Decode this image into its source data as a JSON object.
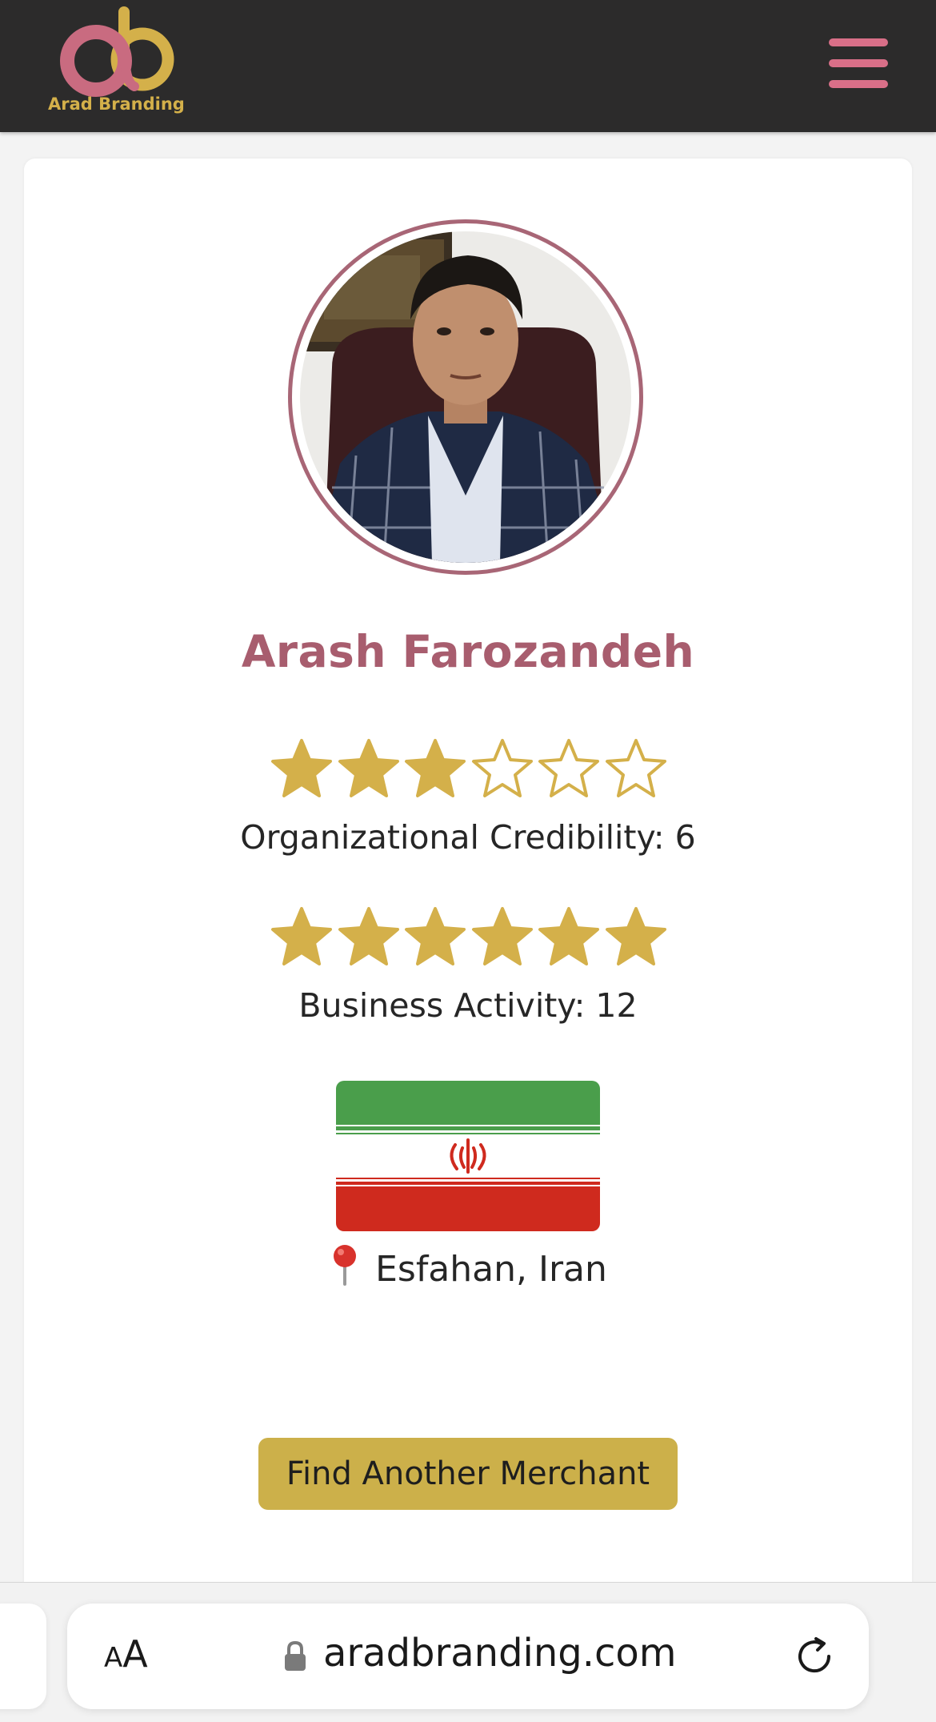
{
  "header": {
    "logo_text": "Arad Branding",
    "logo_icon": "arad-branding-logo",
    "menu_icon": "hamburger-menu-icon",
    "colors": {
      "bar": "#2c2b2b",
      "accent_pink": "#d96f88",
      "accent_gold": "#d4b04a"
    }
  },
  "profile": {
    "name": "Arash Farozandeh",
    "photo_icon": "profile-photo",
    "organizational_credibility": {
      "label": "Organizational Credibility: 6",
      "stars_filled": 3,
      "stars_total": 6
    },
    "business_activity": {
      "label": "Business Activity: 12",
      "stars_filled": 6,
      "stars_total": 6
    },
    "flag_icon": "iran-flag",
    "location_icon": "map-pin-icon",
    "location": "Esfahan, Iran"
  },
  "actions": {
    "find_another": "Find Another Merchant"
  },
  "browser": {
    "text_size_small": "A",
    "text_size_big": "A",
    "url": "aradbranding.com",
    "lock_icon": "lock-icon",
    "reload_icon": "reload-icon"
  },
  "colors": {
    "star_gold": "#d4b04a",
    "name_color": "#a85d6e",
    "button_gold": "#ccb04a",
    "avatar_ring": "#a86676"
  }
}
